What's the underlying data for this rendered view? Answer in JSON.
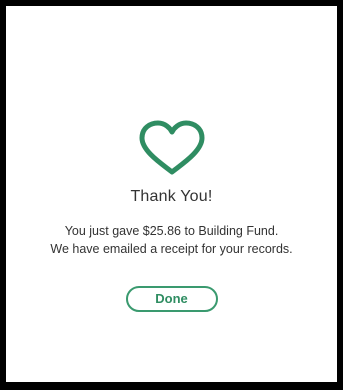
{
  "confirmation": {
    "title": "Thank You!",
    "message_line_1": "You just gave $25.86 to Building Fund.",
    "message_line_2": "We have emailed a receipt for your records."
  },
  "actions": {
    "done_label": "Done"
  },
  "colors": {
    "accent": "#2f8d62",
    "icon": "heart-outline-icon"
  }
}
